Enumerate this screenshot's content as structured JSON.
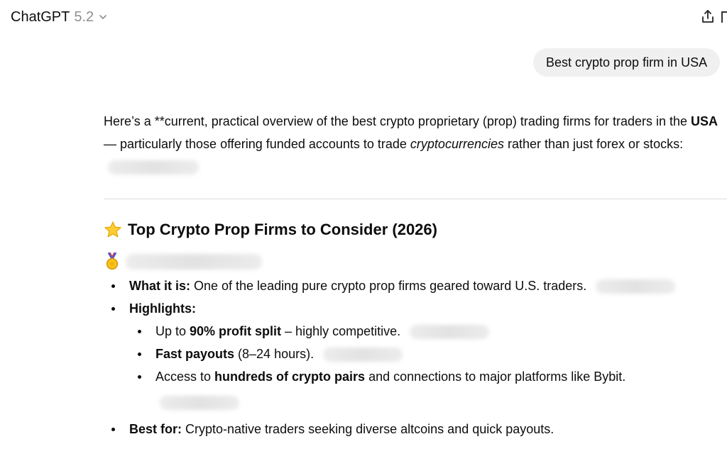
{
  "header": {
    "model_name": "ChatGPT",
    "model_version": "5.2",
    "icons": [
      "chevron-down-icon",
      "share-icon"
    ]
  },
  "user_message": "Best crypto prop firm in USA",
  "response": {
    "intro": {
      "part1": "Here’s a **current, practical overview of the best crypto proprietary (prop) trading firms for traders in the ",
      "usa": "USA",
      "part2": " — particularly those offering funded accounts to trade ",
      "crypto_italic": "cryptocurrencies",
      "part3": " rather than just forex or stocks:"
    },
    "section_title": "Top Crypto Prop Firms to Consider (2026)",
    "list": {
      "what_label": "What it is:",
      "what_text": " One of the leading pure crypto prop firms geared toward U.S. traders.",
      "highlights_label": "Highlights:",
      "h1_pre": "Up to ",
      "h1_bold": "90% profit split",
      "h1_post": " – highly competitive.",
      "h2_bold": "Fast payouts",
      "h2_post": " (8–24 hours).",
      "h3_pre": "Access to ",
      "h3_bold": "hundreds of crypto pairs",
      "h3_post": " and connections to major platforms like Bybit.",
      "best_label": "Best for:",
      "best_text": " Crypto-native traders seeking diverse altcoins and quick payouts."
    }
  },
  "colors": {
    "bubble_bg": "#f0f0f0",
    "muted": "#8f8f8f",
    "text": "#0d0d0d"
  }
}
